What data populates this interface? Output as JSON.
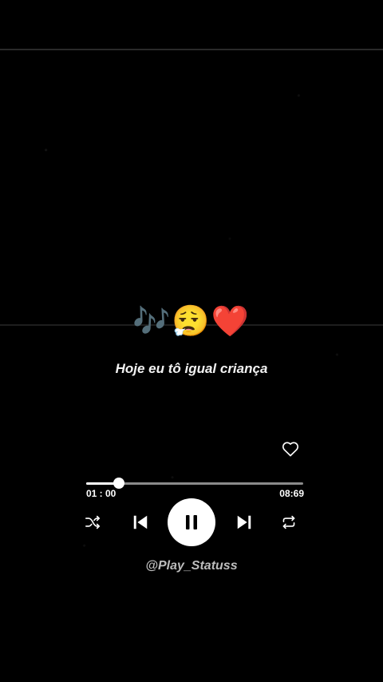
{
  "lyric": {
    "emojis": "🎶😮‍💨❤️",
    "line": "Hoje eu tô igual criança"
  },
  "player": {
    "elapsed": "01 : 00",
    "duration": "08:69",
    "progress_fraction": 0.15,
    "like_icon": "heart-outline-icon",
    "controls": [
      "shuffle-icon",
      "skip-previous-icon",
      "pause-icon",
      "skip-next-icon",
      "repeat-icon"
    ]
  },
  "credit": {
    "handle": "@Play_Statuss"
  },
  "colors": {
    "background": "#000000",
    "foreground": "#ffffff",
    "track": "#8a8a8a"
  }
}
